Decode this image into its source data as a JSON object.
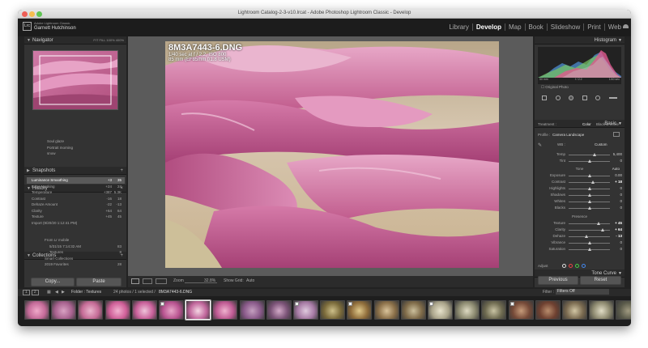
{
  "window_title": "Lightroom Catalog-2-3-v10.lrcat - Adobe Photoshop Lightroom Classic - Develop",
  "identity_plate": {
    "line1": "Adobe Lightroom Classic",
    "line2": "Garnett Hutchinson",
    "logo": "Lrc"
  },
  "modules": [
    "Library",
    "Develop",
    "Map",
    "Book",
    "Slideshow",
    "Print",
    "Web"
  ],
  "active_module": "Develop",
  "left": {
    "navigator": {
      "title": "Navigator",
      "zoom": [
        "FIT",
        "FILL",
        "100%",
        "400%"
      ]
    },
    "presets": [
      "Soul glaze",
      "Portrait morning",
      "snow"
    ],
    "snapshots_title": "Snapshots",
    "history_title": "History",
    "history": [
      {
        "label": "Luminance Smoothing",
        "a": "+3",
        "b": "35"
      },
      {
        "label": "Edge Masking",
        "a": "+24",
        "b": "24"
      },
      {
        "label": "Temperature",
        "a": "+387",
        "b": "5.3K"
      },
      {
        "label": "Contrast",
        "a": "-16",
        "b": "18"
      },
      {
        "label": "Dehaze Amount",
        "a": "-22",
        "b": "-13"
      },
      {
        "label": "Clarity",
        "a": "+64",
        "b": "64"
      },
      {
        "label": "Texture",
        "a": "+45",
        "b": "45"
      },
      {
        "label": "Import (9/20/20 1:12:41 PM)",
        "a": "",
        "b": ""
      }
    ],
    "collections_title": "Collections",
    "collections": [
      {
        "label": "From Lr mobile",
        "count": ""
      },
      {
        "label": "5/31/15 7:14:32 AM",
        "count": "83"
      },
      {
        "label": "Textures",
        "count": "8"
      },
      {
        "label": "Smart Collections",
        "count": ""
      },
      {
        "label": "2019 Favorites",
        "count": "28"
      }
    ],
    "copy_button": "Copy...",
    "paste_button": "Paste"
  },
  "photo": {
    "filename": "8M3A7443-6.DNG",
    "exposure": "1/40 sec at f / 2.2, ISO 800",
    "lens": "85 mm (EF85mm f/1.8 USM)"
  },
  "toolbar": {
    "zoom_label": "Zoom",
    "zoom_value": "32.8%",
    "show_grid_label": "Show Grid:",
    "show_grid_value": "Auto"
  },
  "right": {
    "histogram_title": "Histogram",
    "histogram_info": [
      "50 mm",
      "f / 2.2",
      "1/40 sec"
    ],
    "original_photo": "Original Photo",
    "basic_title": "Basic",
    "treatment_label": "Treatment :",
    "treatment_color": "Color",
    "treatment_bw": "Black & White",
    "profile_label": "Profile :",
    "profile_value": "Camera Landscape",
    "wb_label": "WB :",
    "wb_value": "Custom",
    "temp": {
      "label": "Temp",
      "value": "5,400",
      "pos": 0.62
    },
    "tint": {
      "label": "Tint",
      "value": "0",
      "pos": 0.5
    },
    "tone_label": "Tone",
    "tone_auto": "Auto",
    "tone": [
      {
        "label": "Exposure",
        "value": "0.00",
        "pos": 0.5,
        "hi": false
      },
      {
        "label": "Contrast",
        "value": "+ 18",
        "pos": 0.59,
        "hi": true
      },
      {
        "label": "Highlights",
        "value": "0",
        "pos": 0.5,
        "hi": false
      },
      {
        "label": "Shadows",
        "value": "0",
        "pos": 0.5,
        "hi": false
      },
      {
        "label": "Whites",
        "value": "0",
        "pos": 0.5,
        "hi": false
      },
      {
        "label": "Blacks",
        "value": "0",
        "pos": 0.5,
        "hi": false
      }
    ],
    "presence_label": "Presence",
    "presence": [
      {
        "label": "Texture",
        "value": "+ 45",
        "pos": 0.72,
        "hi": true
      },
      {
        "label": "Clarity",
        "value": "+ 64",
        "pos": 0.82,
        "hi": true
      },
      {
        "label": "Dehaze",
        "value": "- 13",
        "pos": 0.43,
        "hi": true
      },
      {
        "label": "Vibrance",
        "value": "0",
        "pos": 0.5,
        "hi": false
      },
      {
        "label": "Saturation",
        "value": "0",
        "pos": 0.5,
        "hi": false
      }
    ],
    "tone_curve_title": "Tone Curve",
    "adjust_label": "Adjust",
    "previous_button": "Previous",
    "reset_button": "Reset"
  },
  "filmstrip": {
    "pages": [
      "1",
      "2"
    ],
    "folder_text": "Folder : Textures",
    "count_text": "24 photos / 1 selected /",
    "selected_file": "8M3A7443-6.DNG",
    "filter_label": "Filter :",
    "filter_value": "Filters Off",
    "thumbs": [
      {
        "c1": "#c46a98",
        "c2": "#f0a9c9",
        "badge": false
      },
      {
        "c1": "#a8628f",
        "c2": "#d9a2c3",
        "badge": false
      },
      {
        "c1": "#c56b96",
        "c2": "#eab5cd",
        "badge": false
      },
      {
        "c1": "#cf5f98",
        "c2": "#f2b1d0",
        "badge": false
      },
      {
        "c1": "#c9609a",
        "c2": "#eec4da",
        "badge": false
      },
      {
        "c1": "#b85390",
        "c2": "#e7a6c8",
        "badge": true
      },
      {
        "c1": "#c0659b",
        "c2": "#f5d6e4",
        "badge": false
      },
      {
        "c1": "#bf5a93",
        "c2": "#efb2cf",
        "badge": false
      },
      {
        "c1": "#8a5a8a",
        "c2": "#c49fbf",
        "badge": false
      },
      {
        "c1": "#7a5276",
        "c2": "#d3aac8",
        "badge": false
      },
      {
        "c1": "#a67aa4",
        "c2": "#dfcade",
        "badge": true
      },
      {
        "c1": "#7a6a3a",
        "c2": "#cdbf89",
        "badge": false
      },
      {
        "c1": "#8e6c3a",
        "c2": "#e0c98b",
        "badge": true
      },
      {
        "c1": "#8a6f48",
        "c2": "#d9c39a",
        "badge": false
      },
      {
        "c1": "#7e6a48",
        "c2": "#cbbf9c",
        "badge": false
      },
      {
        "c1": "#aaa48a",
        "c2": "#e8e3cc",
        "badge": true
      },
      {
        "c1": "#8c8a70",
        "c2": "#dedac2",
        "badge": false
      },
      {
        "c1": "#6e6a50",
        "c2": "#c9c3a3",
        "badge": false
      },
      {
        "c1": "#764a38",
        "c2": "#c69b7a",
        "badge": true
      },
      {
        "c1": "#6e4030",
        "c2": "#b88c6c",
        "badge": false
      },
      {
        "c1": "#7a6a50",
        "c2": "#d2c6a4",
        "badge": false
      },
      {
        "c1": "#8e8a70",
        "c2": "#e1ddc6",
        "badge": false
      },
      {
        "c1": "#5a5a4a",
        "c2": "#a09a80",
        "badge": false
      }
    ],
    "selected_index": 6
  },
  "colors": {
    "pink": "#d77aa8",
    "bg": "#5b5b5b",
    "panel": "#333333"
  }
}
